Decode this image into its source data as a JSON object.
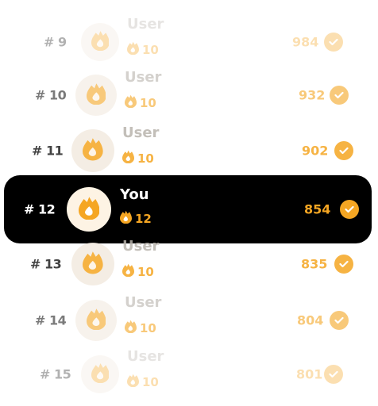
{
  "colors": {
    "accent": "#f5a623",
    "highlight_bg": "#000000"
  },
  "rows": [
    {
      "rank": "# 9",
      "name": "User",
      "level": "10",
      "score": "984",
      "current": false
    },
    {
      "rank": "# 10",
      "name": "User",
      "level": "10",
      "score": "932",
      "current": false
    },
    {
      "rank": "# 11",
      "name": "User",
      "level": "10",
      "score": "902",
      "current": false
    },
    {
      "rank": "# 12",
      "name": "You",
      "level": "12",
      "score": "854",
      "current": true
    },
    {
      "rank": "# 13",
      "name": "User",
      "level": "10",
      "score": "835",
      "current": false
    },
    {
      "rank": "# 14",
      "name": "User",
      "level": "10",
      "score": "804",
      "current": false
    },
    {
      "rank": "# 15",
      "name": "User",
      "level": "10",
      "score": "801",
      "current": false
    }
  ]
}
